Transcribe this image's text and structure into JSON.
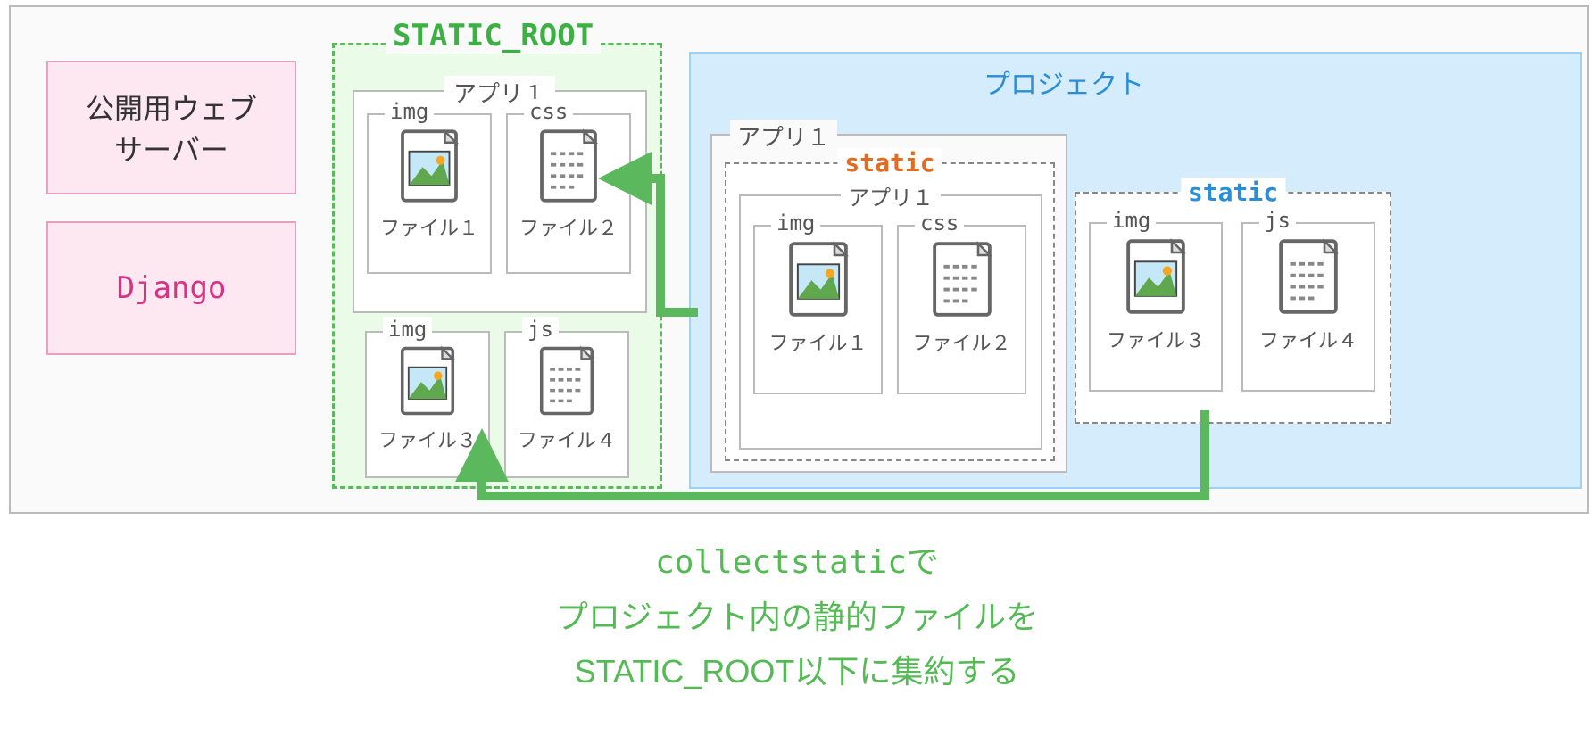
{
  "outer": {
    "web_server_label": "公開用ウェブ\nサーバー",
    "django_label": "Django"
  },
  "static_root": {
    "title": "STATIC_ROOT",
    "app_label": "アプリ１",
    "folders": {
      "img1": {
        "type": "img",
        "file": "ファイル１"
      },
      "css": {
        "type": "css",
        "file": "ファイル２"
      },
      "img2": {
        "type": "img",
        "file": "ファイル３"
      },
      "js": {
        "type": "js",
        "file": "ファイル４"
      }
    }
  },
  "project": {
    "title": "プロジェクト",
    "app1": {
      "outer_label": "アプリ１",
      "static_label": "static",
      "inner_label": "アプリ１",
      "folders": {
        "img": {
          "type": "img",
          "file": "ファイル１"
        },
        "css": {
          "type": "css",
          "file": "ファイル２"
        }
      }
    },
    "static2": {
      "label": "static",
      "folders": {
        "img": {
          "type": "img",
          "file": "ファイル３"
        },
        "js": {
          "type": "js",
          "file": "ファイル４"
        }
      }
    }
  },
  "caption": {
    "line1": "collectstaticで",
    "line2": "プロジェクト内の静的ファイルを",
    "line3": "STATIC_ROOT以下に集約する"
  },
  "colors": {
    "green": "#5cb85c",
    "orange": "#e36b1e",
    "blue": "#2a8ed6",
    "pink": "#d63384"
  }
}
